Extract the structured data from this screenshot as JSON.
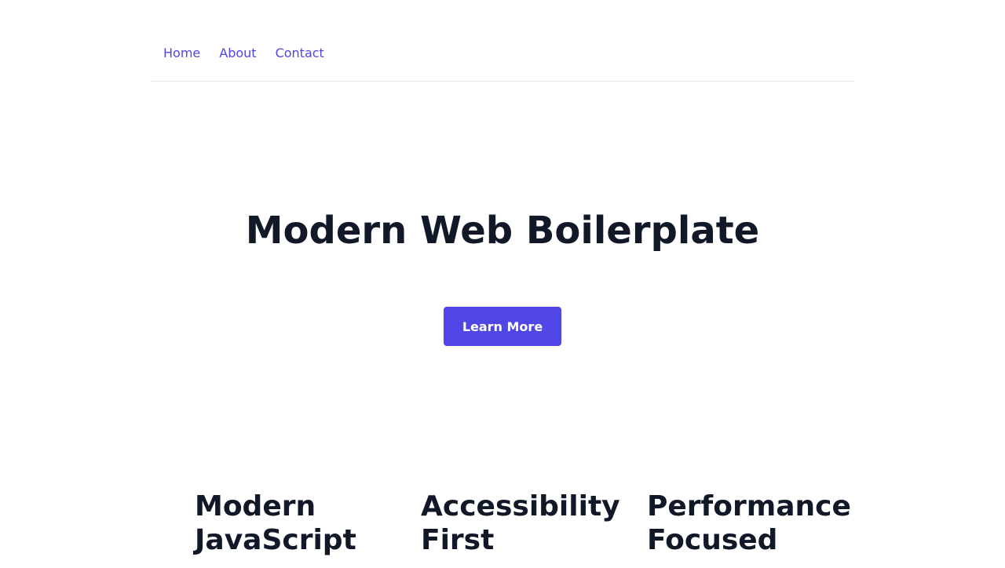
{
  "nav": {
    "items": [
      {
        "label": "Home"
      },
      {
        "label": "About"
      },
      {
        "label": "Contact"
      }
    ]
  },
  "hero": {
    "title": "Modern Web Boilerplate",
    "button_label": "Learn More"
  },
  "features": [
    {
      "title": "Modern\nJavaScript"
    },
    {
      "title": "Accessibility\nFirst"
    },
    {
      "title": "Performance\nFocused"
    }
  ],
  "colors": {
    "accent": "#4f46e5",
    "heading": "#111827",
    "divider": "#e5e7eb",
    "background": "#ffffff"
  }
}
